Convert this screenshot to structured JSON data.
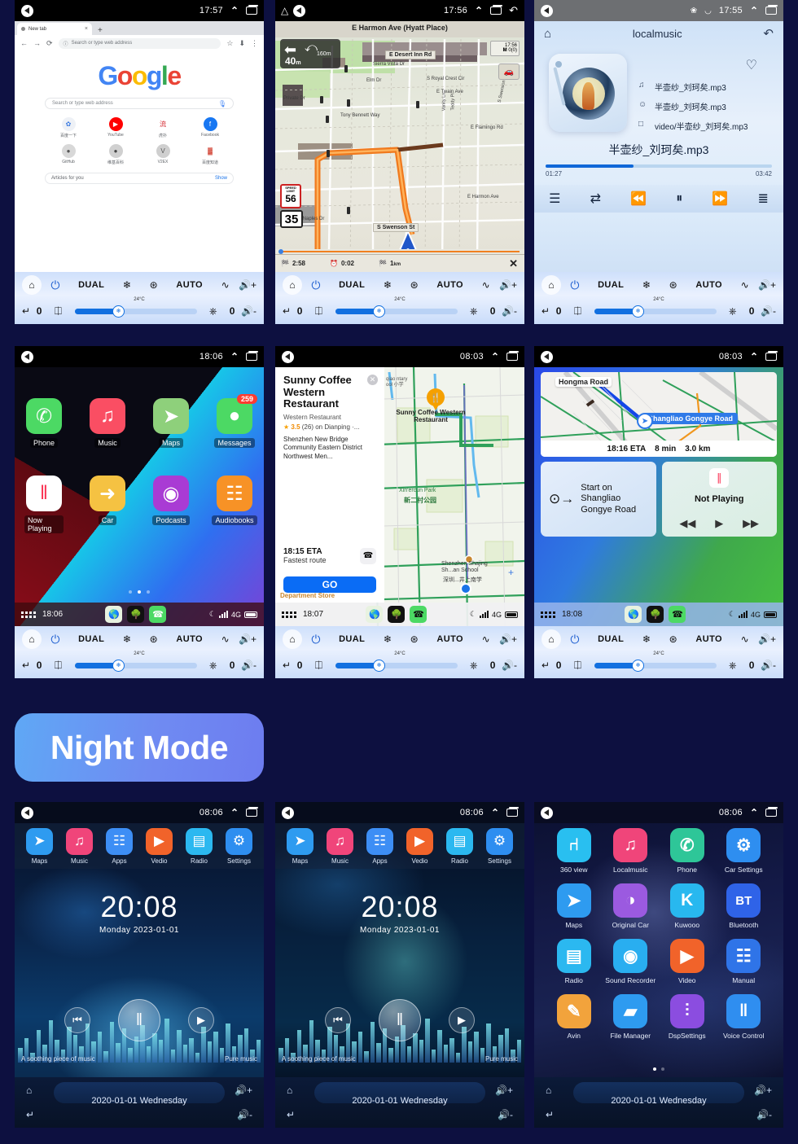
{
  "banner": {
    "label": "Night Mode"
  },
  "climate": {
    "power": "power-icon",
    "dual": "DUAL",
    "snow": "snowflake-icon",
    "recirc": "recirculate-icon",
    "auto": "AUTO",
    "defrost": "defrost-icon",
    "vol_up": "+",
    "vol_down": "-",
    "temp": "24°C",
    "left_temp": "0",
    "right_temp": "0",
    "seat_left": "seat-icon",
    "seat_right": "seat-heat-icon"
  },
  "panels": {
    "browser": {
      "status": {
        "time": "17:57"
      },
      "tab": {
        "title": "New tab",
        "close": "×",
        "new": "+"
      },
      "omnibox": {
        "placeholder": "Search or type web address",
        "back": "←",
        "forward": "→",
        "reload": "⟳",
        "star": "☆",
        "download": "⬇",
        "menu": "⋮"
      },
      "logo": {
        "g1": "G",
        "o1": "o",
        "o2": "o",
        "g2": "g",
        "l": "l",
        "e": "e"
      },
      "search": {
        "placeholder": "Search or type web address",
        "mic": "mic-icon"
      },
      "shortcuts": [
        {
          "name": "百度一下",
          "glyph": "✿",
          "color": "#eef1f6",
          "fg": "#3b7ae0"
        },
        {
          "name": "YouTube",
          "glyph": "▶",
          "color": "#ff0000",
          "fg": "#ffffff"
        },
        {
          "name": "虎扑",
          "glyph": "流",
          "color": "#ffffff",
          "fg": "#d2232a"
        },
        {
          "name": "Facebook",
          "glyph": "f",
          "color": "#1877f2",
          "fg": "#ffffff"
        },
        {
          "name": "GitHub",
          "glyph": "●",
          "color": "#d8d8d8",
          "fg": "#555555"
        },
        {
          "name": "维基百科",
          "glyph": "●",
          "color": "#d0d0d0",
          "fg": "#444444"
        },
        {
          "name": "V2EX",
          "glyph": "V",
          "color": "#cfcfcf",
          "fg": "#555555"
        },
        {
          "name": "百度知道",
          "glyph": "▓",
          "color": "#ffffff",
          "fg": "#d03a2a"
        }
      ],
      "articles": {
        "label": "Articles for you",
        "show": "Show"
      }
    },
    "navmap": {
      "status": {
        "time": "17:56"
      },
      "top_road": "E Harmon Ave (Hyatt Place)",
      "turn": {
        "distance": "40",
        "unit": "m",
        "second_distance": "160",
        "second_unit": "m"
      },
      "clock_box": {
        "time": "17:56",
        "sat": "0(0)"
      },
      "roads": [
        "E Desert Inn Rd",
        "Sierra Vista Dr",
        "Elm Dr",
        "S Royal Crest Cir",
        "E Twain Ave",
        "Tony Bennett Way",
        "Private Dr",
        "Vanity Ln",
        "Teddy Pl",
        "S Swenson St",
        "E Flamingo Rd",
        "E Naples Dr",
        "E Harmon Ave"
      ],
      "speed_limit": {
        "label": "SPEED LIMIT",
        "value": "56"
      },
      "current_speed": "35",
      "footer": {
        "remaining_time": "2:58",
        "eta": "0:02",
        "distance": "1",
        "distance_unit": "km",
        "close": "✕"
      }
    },
    "music": {
      "status": {
        "time": "17:55",
        "bt": "bluetooth-icon",
        "wifi": "wifi-icon"
      },
      "title": "localmusic",
      "home": "home-icon",
      "back": "back-icon",
      "favorite": "heart-icon",
      "track": "半壶纱_刘珂矣.mp3",
      "artist": "半壶纱_刘珂矣.mp3",
      "album": "video/半壶纱_刘珂矣.mp3",
      "now_title": "半壶纱_刘珂矣.mp3",
      "elapsed": "01:27",
      "duration": "03:42",
      "controls": [
        "list-icon",
        "shuffle-icon",
        "previous-icon",
        "pause-icon",
        "next-icon",
        "equalizer-icon"
      ]
    },
    "carplay_home": {
      "status": {
        "time": "18:06"
      },
      "apps_row1": [
        {
          "name": "Phone",
          "glyph": "✆",
          "color": "#4cd964"
        },
        {
          "name": "Music",
          "glyph": "♫",
          "color": "#fa4e63"
        },
        {
          "name": "Maps",
          "glyph": "➤",
          "color": "#8ed07b"
        },
        {
          "name": "Messages",
          "glyph": "●",
          "color": "#4cd964",
          "badge": "259"
        }
      ],
      "apps_row2": [
        {
          "name": "Now Playing",
          "glyph": "‖",
          "color": "#ffffff"
        },
        {
          "name": "Car",
          "glyph": "➜",
          "color": "#f5c242"
        },
        {
          "name": "Podcasts",
          "glyph": "◉",
          "color": "#a93bd4"
        },
        {
          "name": "Audiobooks",
          "glyph": "☷",
          "color": "#f79226"
        }
      ],
      "dock": {
        "time": "18:06",
        "network": "4G",
        "moon": "☾"
      }
    },
    "carplay_poi": {
      "status": {
        "time": "08:03"
      },
      "poi": {
        "name": "Sunny Coffee Western Restaurant",
        "category": "Western Restaurant",
        "rating": "3.5",
        "reviews": "(26) on Dianping ·...",
        "address": "Shenzhen New Bridge Community Eastern District Northwest Men...",
        "eta": "18:15 ETA",
        "route": "Fastest route",
        "go": "GO",
        "call": "phone-icon",
        "close": "✕"
      },
      "map_labels": [
        "Xin'ercun Park",
        "新二村公园",
        "Shenzhen Shajing Sh...an School",
        "深圳...井上南学",
        "Department Store",
        "Sunny Coffee Western Restaurant",
        "qiao ntary ool 小学"
      ],
      "dock": {
        "time": "18:07",
        "network": "4G",
        "moon": "☾"
      }
    },
    "carplay_dash": {
      "status": {
        "time": "08:03"
      },
      "map": {
        "road_label": "Hongma Road",
        "current_road": "Shangliao Gongye Road",
        "eta": "18:16 ETA",
        "duration": "8 min",
        "distance": "3.0 km"
      },
      "turn_card": {
        "instruction": "Start on Shangliao Gongye Road",
        "icon": "turn-arrow-icon"
      },
      "np_card": {
        "title": "Not Playing",
        "prev": "◀◀",
        "play": "▶",
        "next": "▶▶"
      },
      "dock": {
        "time": "18:08",
        "network": "4G",
        "moon": "☾"
      }
    },
    "night_launcher_a": {
      "status": {
        "time": "08:06"
      },
      "apps": [
        {
          "name": "Maps",
          "glyph": "➤",
          "color": "#2e9bf0"
        },
        {
          "name": "Music",
          "glyph": "♫",
          "color": "#f0457a"
        },
        {
          "name": "Apps",
          "glyph": "☷",
          "color": "#3d8ef5"
        },
        {
          "name": "Vedio",
          "glyph": "▶",
          "color": "#f1632a"
        },
        {
          "name": "Radio",
          "glyph": "▤",
          "color": "#2bb8f0"
        },
        {
          "name": "Settings",
          "glyph": "⚙",
          "color": "#2e8ef0"
        }
      ],
      "clock": {
        "time": "20:08",
        "date": "Monday  2023-01-01"
      },
      "player": {
        "left_text": "A soothing piece of music",
        "right_text": "Pure music",
        "prev": "⏮",
        "play": "▶",
        "pause": "‖"
      },
      "bottom": {
        "date": "2020-01-01  Wednesday",
        "home": "home-icon",
        "back": "back-icon",
        "vol_up": "+",
        "vol_down": "-"
      }
    },
    "night_launcher_b": {
      "status": {
        "time": "08:06"
      },
      "apps": [
        {
          "name": "Maps",
          "glyph": "➤",
          "color": "#2e9bf0"
        },
        {
          "name": "Music",
          "glyph": "♫",
          "color": "#f0457a"
        },
        {
          "name": "Apps",
          "glyph": "☷",
          "color": "#3d8ef5"
        },
        {
          "name": "Vedio",
          "glyph": "▶",
          "color": "#f1632a"
        },
        {
          "name": "Radio",
          "glyph": "▤",
          "color": "#2bb8f0"
        },
        {
          "name": "Settings",
          "glyph": "⚙",
          "color": "#2e8ef0"
        }
      ],
      "clock": {
        "time": "20:08",
        "date": "Monday  2023-01-01"
      },
      "player": {
        "left_text": "A soothing piece of music",
        "right_text": "Pure music",
        "prev": "⏮",
        "play": "▶",
        "pause": "‖"
      },
      "bottom": {
        "date": "2020-01-01  Wednesday",
        "home": "home-icon",
        "back": "back-icon",
        "vol_up": "+",
        "vol_down": "-"
      }
    },
    "night_apps": {
      "status": {
        "time": "08:06"
      },
      "apps": [
        {
          "name": "360 view",
          "glyph": "⑁",
          "color": "#29bff0"
        },
        {
          "name": "Localmusic",
          "glyph": "♫",
          "color": "#f0457a"
        },
        {
          "name": "Phone",
          "glyph": "✆",
          "color": "#2ec698"
        },
        {
          "name": "Car Settings",
          "glyph": "⚙",
          "color": "#2e8ef0"
        },
        {
          "name": "Maps",
          "glyph": "➤",
          "color": "#2e9bf0"
        },
        {
          "name": "Original Car",
          "glyph": "◑",
          "color": "#9b5ae0"
        },
        {
          "name": "Kuwooo",
          "glyph": "K",
          "color": "#28b8ef"
        },
        {
          "name": "Bluetooth",
          "glyph": "BT",
          "color": "#2f63e8"
        },
        {
          "name": "Radio",
          "glyph": "▤",
          "color": "#2bb8f0"
        },
        {
          "name": "Sound Recorder",
          "glyph": "◉",
          "color": "#29aef0"
        },
        {
          "name": "Video",
          "glyph": "▶",
          "color": "#f1632a"
        },
        {
          "name": "Manual",
          "glyph": "☷",
          "color": "#2f74e8"
        },
        {
          "name": "Avin",
          "glyph": "✎",
          "color": "#f2a33c"
        },
        {
          "name": "File Manager",
          "glyph": "▰",
          "color": "#2e9bf0"
        },
        {
          "name": "DspSettings",
          "glyph": "⫶",
          "color": "#8b4de0"
        },
        {
          "name": "Voice Control",
          "glyph": "‖",
          "color": "#2f8ef0"
        }
      ],
      "bottom": {
        "date": "2020-01-01  Wednesday",
        "home": "home-icon",
        "back": "back-icon",
        "vol_up": "+",
        "vol_down": "-"
      }
    }
  }
}
